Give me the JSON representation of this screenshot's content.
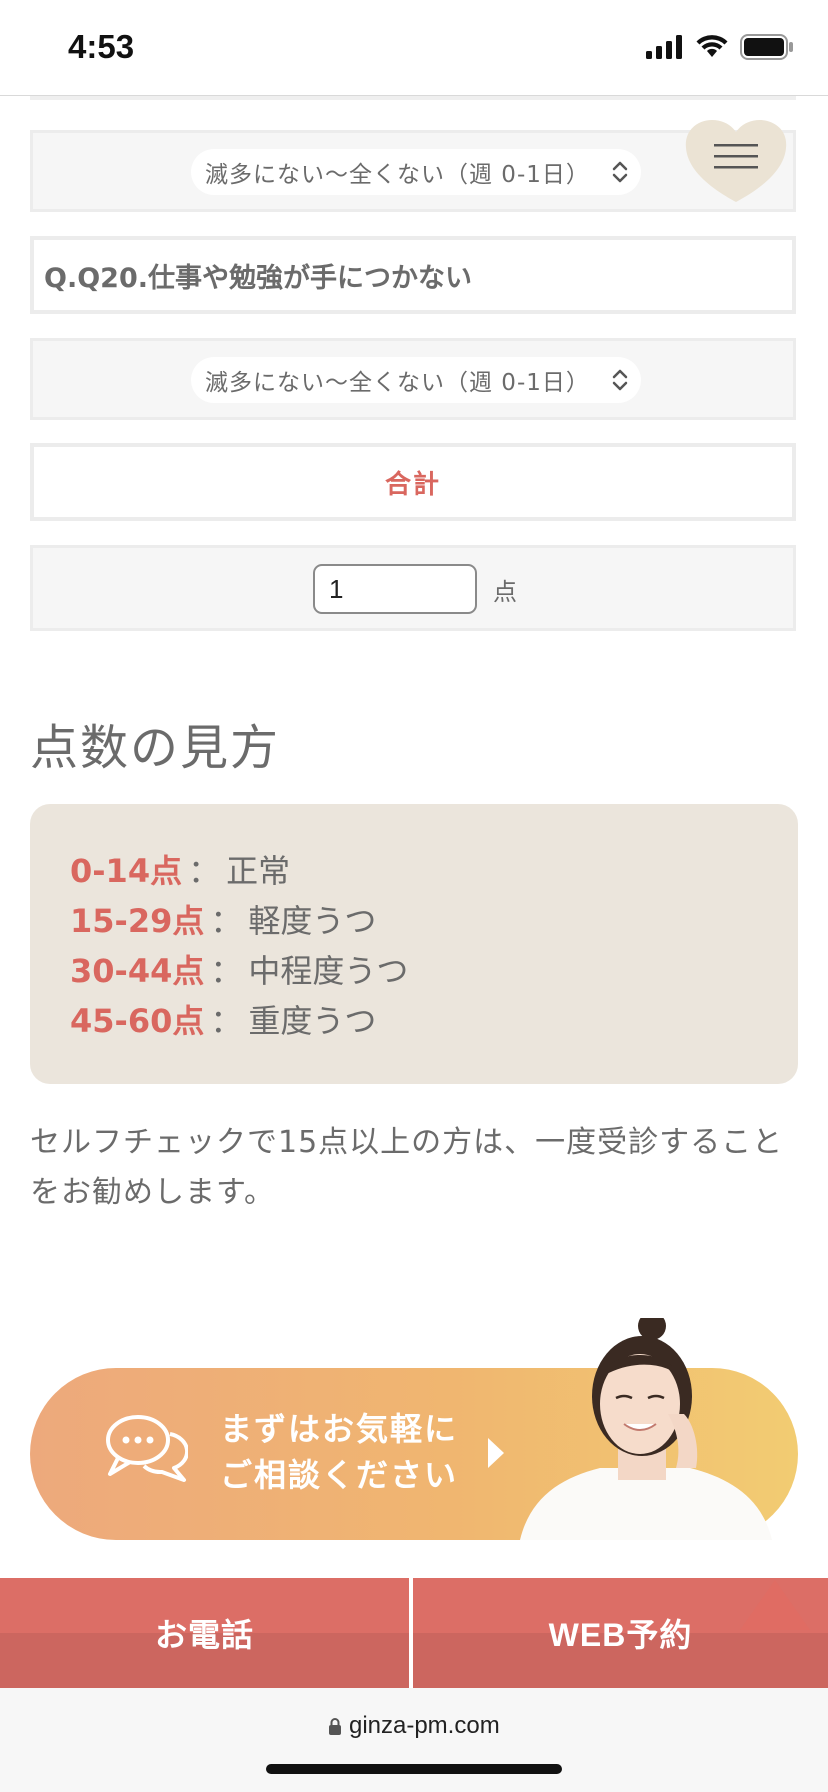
{
  "status_bar": {
    "time": "4:53"
  },
  "questions": {
    "prev_select_value": "滅多にない〜全くない（週 0-1日）",
    "q20_title": "Q.Q20.仕事や勉強が手につかない",
    "q20_select_value": "滅多にない〜全くない（週 0-1日）"
  },
  "total": {
    "label": "合計",
    "value": "1",
    "unit": "点"
  },
  "scoring": {
    "title": "点数の見方",
    "ranges": [
      {
        "range": "0-14点",
        "sep": "：",
        "label": "正常"
      },
      {
        "range": "15-29点",
        "sep": "：",
        "label": "軽度うつ"
      },
      {
        "range": "30-44点",
        "sep": "：",
        "label": "中程度うつ"
      },
      {
        "range": "45-60点",
        "sep": "：",
        "label": "重度うつ"
      }
    ]
  },
  "advice": "セルフチェックで15点以上の方は、一度受診することをお勧めします。",
  "banner": {
    "line1": "まずはお気軽に",
    "line2": "ご相談ください"
  },
  "bottom_bar": {
    "phone_label": "お電話",
    "web_label": "WEB予約"
  },
  "browser": {
    "url": "ginza-pm.com"
  },
  "colors": {
    "accent": "#d9675f",
    "score_bg": "#ebe5dc",
    "bottom_btn": "#dc6e66"
  }
}
